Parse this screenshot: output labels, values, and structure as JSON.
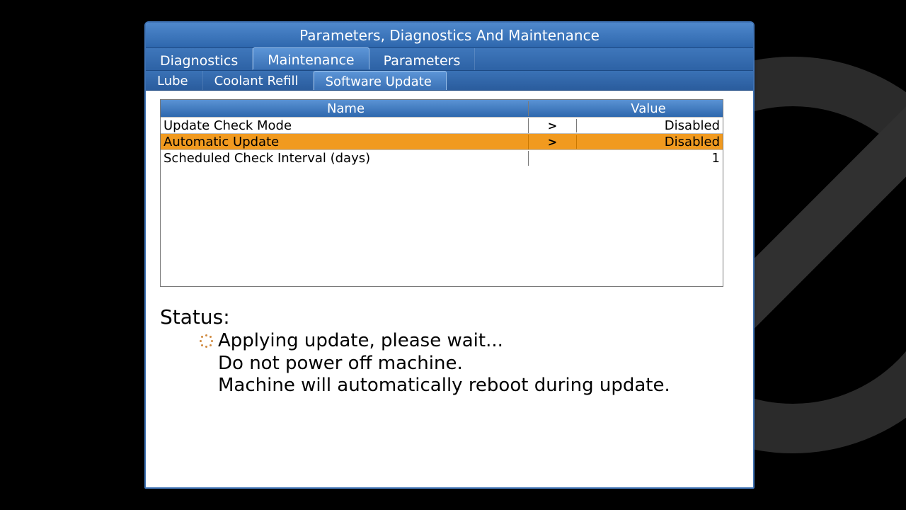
{
  "window": {
    "title": "Parameters, Diagnostics And Maintenance"
  },
  "tabs": [
    {
      "label": "Diagnostics",
      "selected": false
    },
    {
      "label": "Maintenance",
      "selected": true
    },
    {
      "label": "Parameters",
      "selected": false
    }
  ],
  "subtabs": [
    {
      "label": "Lube",
      "selected": false
    },
    {
      "label": "Coolant Refill",
      "selected": false
    },
    {
      "label": "Software Update",
      "selected": true
    }
  ],
  "table": {
    "headers": {
      "name": "Name",
      "value": "Value"
    },
    "rows": [
      {
        "name": "Update Check Mode",
        "arrow": ">",
        "value": "Disabled",
        "selected": false
      },
      {
        "name": "Automatic Update",
        "arrow": ">",
        "value": "Disabled",
        "selected": true
      },
      {
        "name": "Scheduled Check Interval (days)",
        "arrow": "",
        "value": "1",
        "selected": false
      }
    ]
  },
  "status": {
    "label": "Status:",
    "lines": [
      "Applying update, please wait...",
      "Do not power off machine.",
      "Machine will automatically reboot during update."
    ]
  }
}
